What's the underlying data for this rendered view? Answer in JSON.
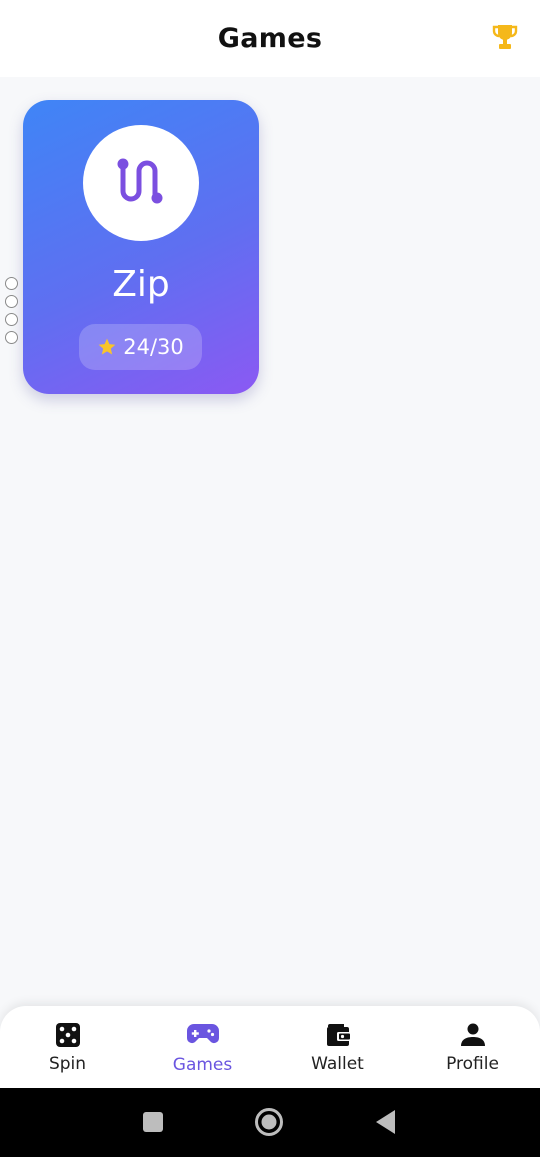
{
  "header": {
    "title": "Games",
    "trophy_icon": "trophy-icon",
    "trophy_color": "#f5b81a"
  },
  "games": [
    {
      "name": "Zip",
      "icon": "path-route-icon",
      "score": "24/30",
      "star_color": "#f9c42a"
    }
  ],
  "nav": {
    "active": "Games",
    "active_color": "#6a55e0",
    "items": [
      {
        "label": "Spin",
        "icon": "dice-icon"
      },
      {
        "label": "Games",
        "icon": "gamepad-icon"
      },
      {
        "label": "Wallet",
        "icon": "wallet-icon"
      },
      {
        "label": "Profile",
        "icon": "person-icon"
      }
    ]
  },
  "colors": {
    "card_gradient_start": "#3f85f6",
    "card_gradient_end": "#8b59f3",
    "background": "#f7f8fa"
  }
}
